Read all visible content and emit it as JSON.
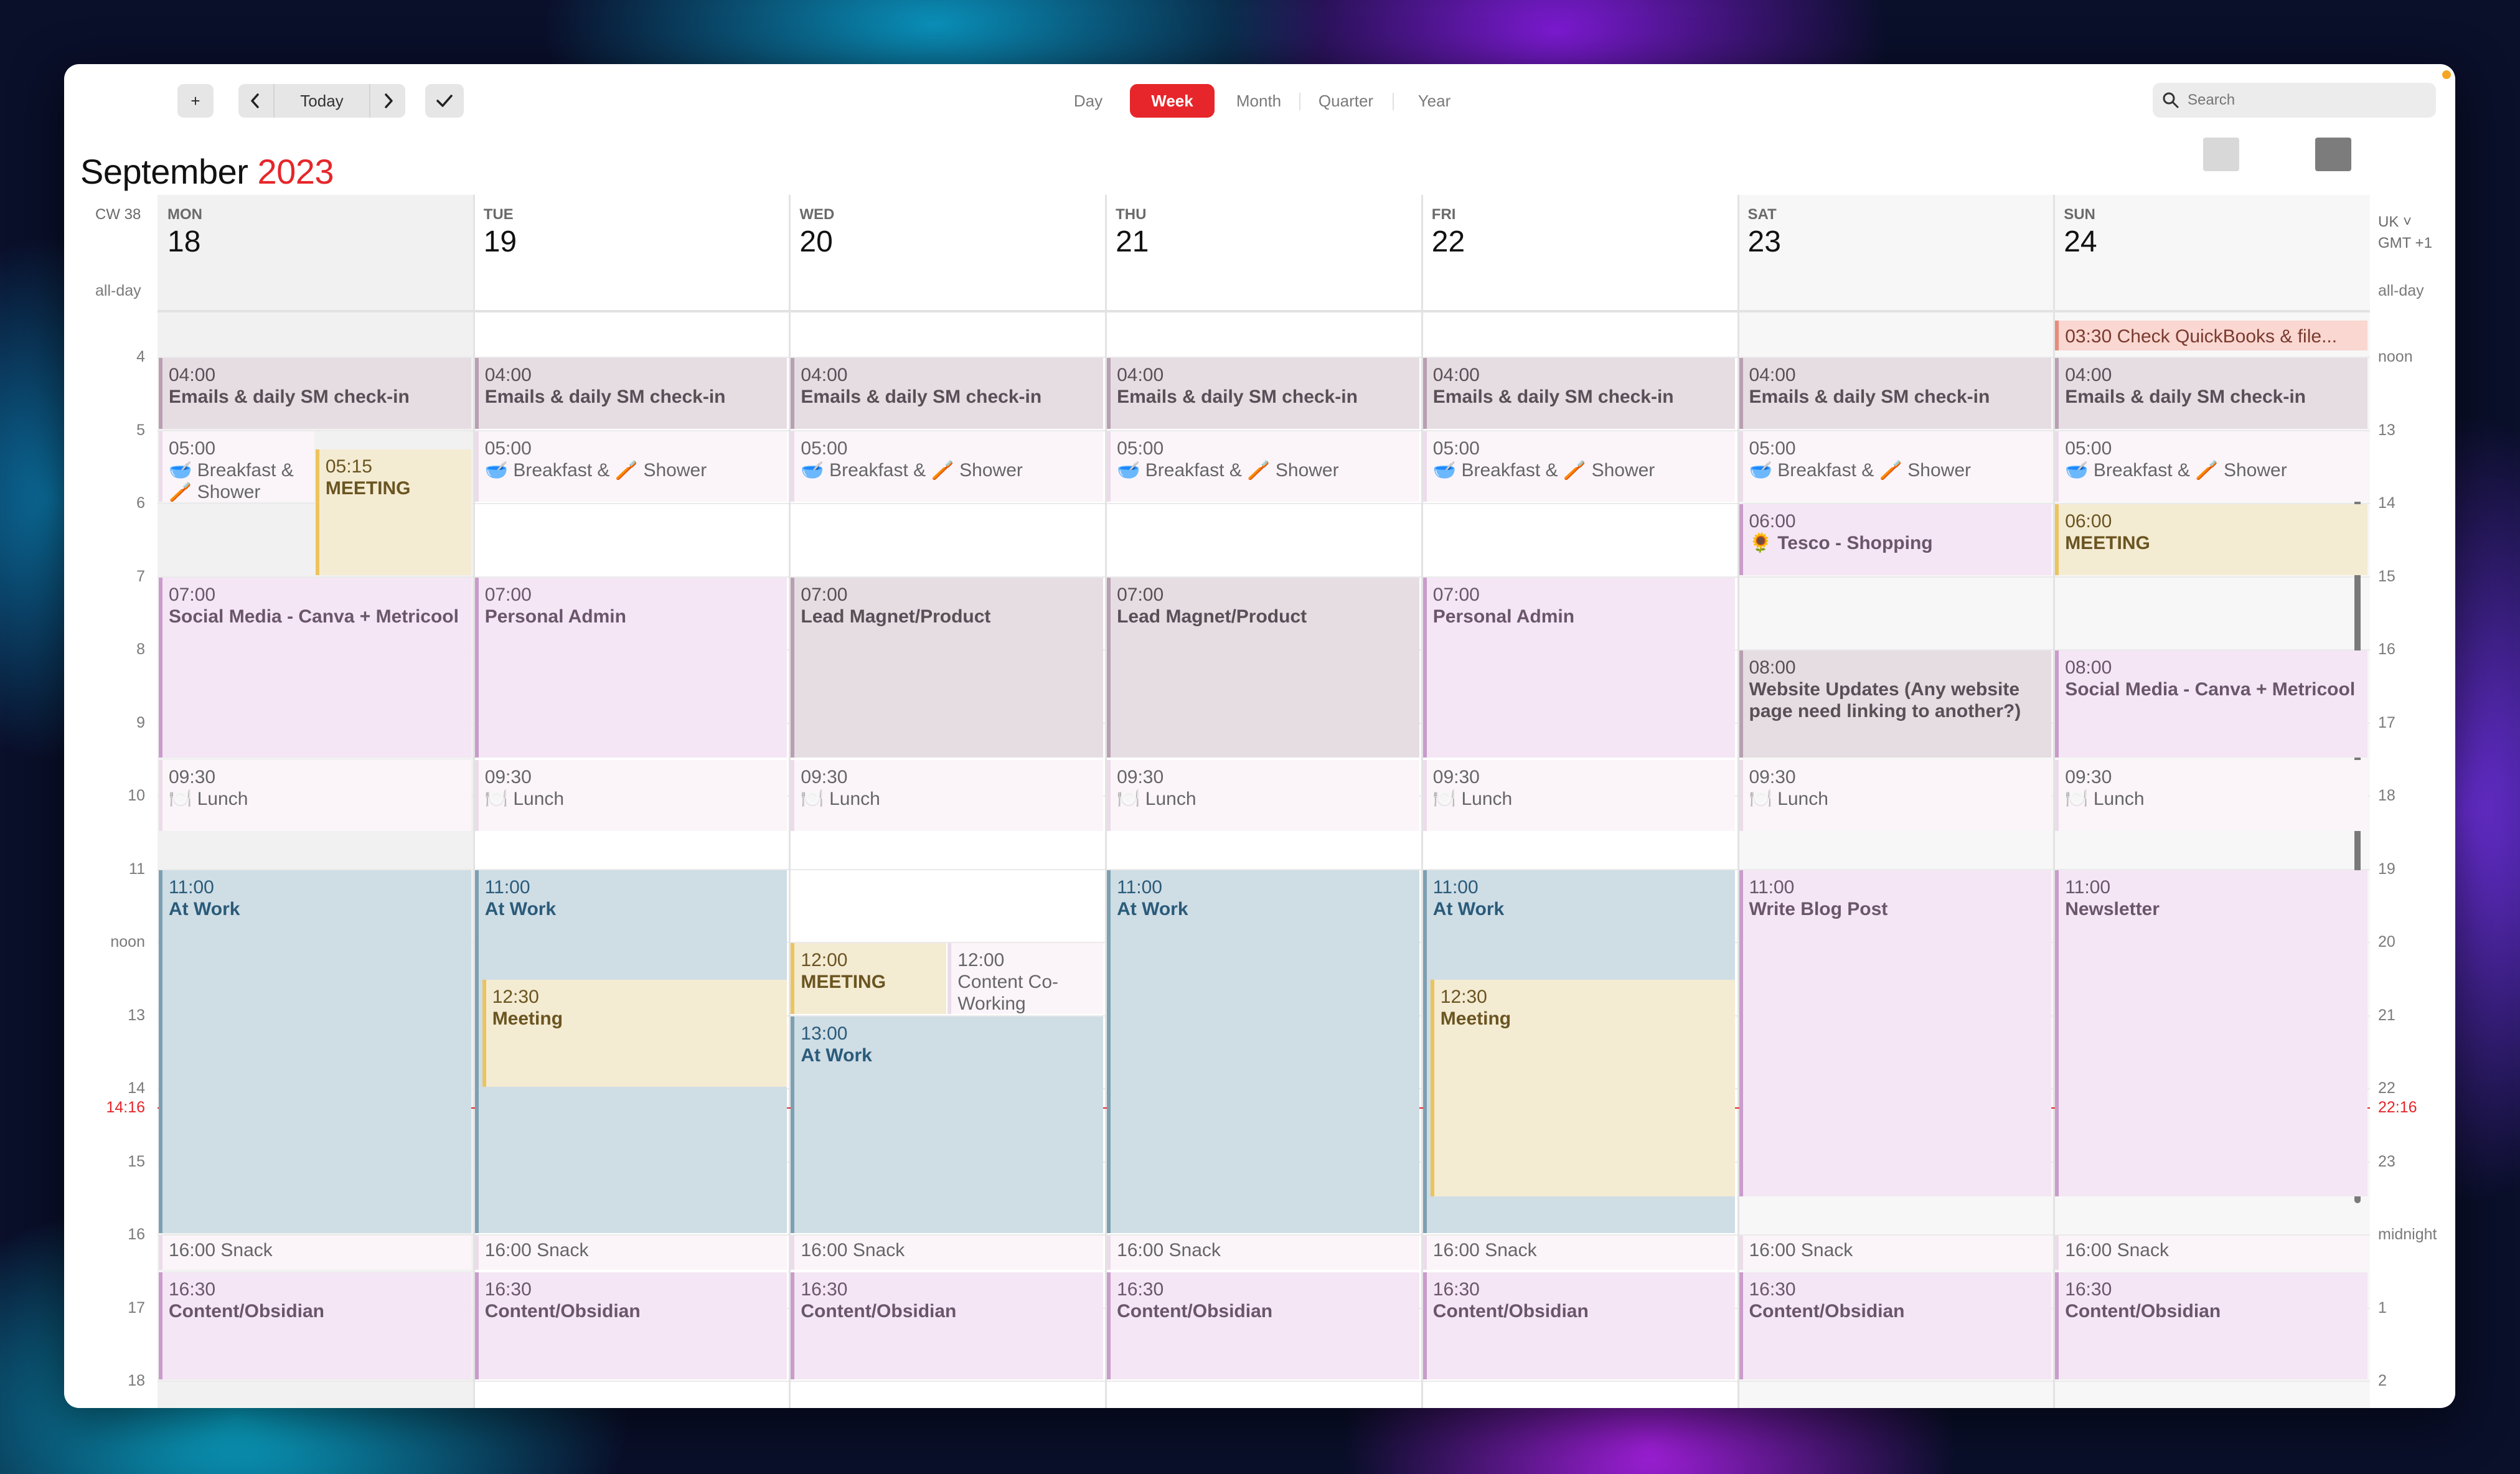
{
  "toolbar": {
    "add": "+",
    "today": "Today"
  },
  "views": [
    "Day",
    "Week",
    "Month",
    "Quarter",
    "Year"
  ],
  "active_view": "Week",
  "search": {
    "placeholder": "Search"
  },
  "header": {
    "month": "September",
    "year": "2023",
    "cw": "CW 38",
    "timezone_line1": "UK ˅",
    "timezone_line2": "GMT +1"
  },
  "days": [
    {
      "name": "MON",
      "num": "18"
    },
    {
      "name": "TUE",
      "num": "19"
    },
    {
      "name": "WED",
      "num": "20"
    },
    {
      "name": "THU",
      "num": "21"
    },
    {
      "name": "FRI",
      "num": "22"
    },
    {
      "name": "SAT",
      "num": "23"
    },
    {
      "name": "SUN",
      "num": "24"
    }
  ],
  "allday_label": "all-day",
  "left_hours": [
    "4",
    "5",
    "6",
    "7",
    "8",
    "9",
    "10",
    "11",
    "noon",
    "13",
    "14",
    "15",
    "16",
    "17",
    "18"
  ],
  "right_hours": [
    "noon",
    "13",
    "14",
    "15",
    "16",
    "17",
    "18",
    "19",
    "20",
    "21",
    "22",
    "23",
    "midnight",
    "1",
    "2"
  ],
  "current_time": {
    "local": "14:16",
    "other": "22:16"
  },
  "events": [
    {
      "day": 6,
      "time": "03:30",
      "title": "Check QuickBooks & file...",
      "color": "salmon"
    },
    {
      "day": 0,
      "time": "04:00",
      "title": "Emails & daily SM check-in",
      "color": "grey"
    },
    {
      "day": 1,
      "time": "04:00",
      "title": "Emails & daily SM check-in",
      "color": "grey"
    },
    {
      "day": 2,
      "time": "04:00",
      "title": "Emails & daily SM check-in",
      "color": "grey"
    },
    {
      "day": 3,
      "time": "04:00",
      "title": "Emails & daily SM check-in",
      "color": "grey"
    },
    {
      "day": 4,
      "time": "04:00",
      "title": "Emails & daily SM check-in",
      "color": "grey"
    },
    {
      "day": 5,
      "time": "04:00",
      "title": "Emails & daily SM check-in",
      "color": "grey"
    },
    {
      "day": 6,
      "time": "04:00",
      "title": "Emails & daily SM check-in",
      "color": "grey"
    },
    {
      "day": 0,
      "time": "05:00",
      "title": "🥣 Breakfast & 🪥 Shower",
      "color": "lpink"
    },
    {
      "day": 0,
      "time": "05:15",
      "title": "MEETING",
      "color": "yellow"
    },
    {
      "day": 1,
      "time": "05:00",
      "title": "🥣 Breakfast & 🪥 Shower",
      "color": "lpink"
    },
    {
      "day": 2,
      "time": "05:00",
      "title": "🥣 Breakfast & 🪥 Shower",
      "color": "lpink"
    },
    {
      "day": 3,
      "time": "05:00",
      "title": "🥣 Breakfast & 🪥 Shower",
      "color": "lpink"
    },
    {
      "day": 4,
      "time": "05:00",
      "title": "🥣 Breakfast & 🪥 Shower",
      "color": "lpink"
    },
    {
      "day": 5,
      "time": "05:00",
      "title": "🥣 Breakfast & 🪥 Shower",
      "color": "lpink"
    },
    {
      "day": 6,
      "time": "05:00",
      "title": "🥣 Breakfast & 🪥 Shower",
      "color": "lpink"
    },
    {
      "day": 5,
      "time": "06:00",
      "title": "🌻 Tesco - Shopping",
      "color": "pink"
    },
    {
      "day": 6,
      "time": "06:00",
      "title": "MEETING",
      "color": "yellow"
    },
    {
      "day": 0,
      "time": "07:00",
      "title": "Social Media - Canva + Metricool",
      "color": "pink"
    },
    {
      "day": 1,
      "time": "07:00",
      "title": "Personal Admin",
      "color": "pink"
    },
    {
      "day": 2,
      "time": "07:00",
      "title": "Lead Magnet/Product",
      "color": "grey"
    },
    {
      "day": 3,
      "time": "07:00",
      "title": "Lead Magnet/Product",
      "color": "grey"
    },
    {
      "day": 4,
      "time": "07:00",
      "title": "Personal Admin",
      "color": "pink"
    },
    {
      "day": 5,
      "time": "08:00",
      "title": "Website Updates (Any website page need linking to another?)",
      "color": "grey"
    },
    {
      "day": 6,
      "time": "08:00",
      "title": "Social Media - Canva + Metricool",
      "color": "pink"
    },
    {
      "day": 0,
      "time": "09:30",
      "title": "🍽️ Lunch",
      "color": "lpink"
    },
    {
      "day": 1,
      "time": "09:30",
      "title": "🍽️ Lunch",
      "color": "lpink"
    },
    {
      "day": 2,
      "time": "09:30",
      "title": "🍽️ Lunch",
      "color": "lpink"
    },
    {
      "day": 3,
      "time": "09:30",
      "title": "🍽️ Lunch",
      "color": "lpink"
    },
    {
      "day": 4,
      "time": "09:30",
      "title": "🍽️ Lunch",
      "color": "lpink"
    },
    {
      "day": 5,
      "time": "09:30",
      "title": "🍽️ Lunch",
      "color": "lpink"
    },
    {
      "day": 6,
      "time": "09:30",
      "title": "🍽️ Lunch",
      "color": "lpink"
    },
    {
      "day": 0,
      "time": "11:00",
      "title": "At Work",
      "color": "blue"
    },
    {
      "day": 1,
      "time": "11:00",
      "title": "At Work",
      "color": "blue"
    },
    {
      "day": 1,
      "time": "12:30",
      "title": "Meeting",
      "color": "yellow"
    },
    {
      "day": 2,
      "time": "12:00",
      "title": "MEETING",
      "color": "yellow"
    },
    {
      "day": 2,
      "time": "12:00",
      "title": "Content Co-Working",
      "color": "lpink"
    },
    {
      "day": 2,
      "time": "13:00",
      "title": "At Work",
      "color": "blue"
    },
    {
      "day": 3,
      "time": "11:00",
      "title": "At Work",
      "color": "blue"
    },
    {
      "day": 4,
      "time": "11:00",
      "title": "At Work",
      "color": "blue"
    },
    {
      "day": 4,
      "time": "12:30",
      "title": "Meeting",
      "color": "yellow"
    },
    {
      "day": 5,
      "time": "11:00",
      "title": "Write Blog Post",
      "color": "pink"
    },
    {
      "day": 6,
      "time": "11:00",
      "title": "Newsletter",
      "color": "pink"
    },
    {
      "day": 0,
      "time": "16:00",
      "title": "Snack",
      "color": "lpink"
    },
    {
      "day": 1,
      "time": "16:00",
      "title": "Snack",
      "color": "lpink"
    },
    {
      "day": 2,
      "time": "16:00",
      "title": "Snack",
      "color": "lpink"
    },
    {
      "day": 3,
      "time": "16:00",
      "title": "Snack",
      "color": "lpink"
    },
    {
      "day": 4,
      "time": "16:00",
      "title": "Snack",
      "color": "lpink"
    },
    {
      "day": 5,
      "time": "16:00",
      "title": "Snack",
      "color": "lpink"
    },
    {
      "day": 6,
      "time": "16:00",
      "title": "Snack",
      "color": "lpink"
    },
    {
      "day": 0,
      "time": "16:30",
      "title": "Content/Obsidian",
      "color": "pink"
    },
    {
      "day": 1,
      "time": "16:30",
      "title": "Content/Obsidian",
      "color": "pink"
    },
    {
      "day": 2,
      "time": "16:30",
      "title": "Content/Obsidian",
      "color": "pink"
    },
    {
      "day": 3,
      "time": "16:30",
      "title": "Content/Obsidian",
      "color": "pink"
    },
    {
      "day": 4,
      "time": "16:30",
      "title": "Content/Obsidian",
      "color": "pink"
    },
    {
      "day": 5,
      "time": "16:30",
      "title": "Content/Obsidian",
      "color": "pink"
    },
    {
      "day": 6,
      "time": "16:30",
      "title": "Content/Obsidian",
      "color": "pink"
    }
  ],
  "colors": {
    "accent": "#e6262a",
    "now_line": "#e6262a"
  }
}
